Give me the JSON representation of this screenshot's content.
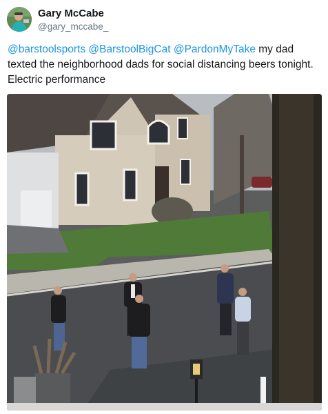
{
  "author": {
    "display_name": "Gary McCabe",
    "handle": "@gary_mccabe_",
    "avatar_icon": "profile-photo-avatar"
  },
  "tweet": {
    "mentions": [
      "@barstoolsports",
      "@BarstoolBigCat",
      "@PardonMyTake"
    ],
    "text": " my dad texted the neighborhood dads for social distancing beers tonight. Electric performance"
  },
  "photo": {
    "subject_icon": "neighborhood-street-photo"
  },
  "colors": {
    "link": "#1b95e0",
    "name": "#14171a",
    "handle": "#657786"
  }
}
